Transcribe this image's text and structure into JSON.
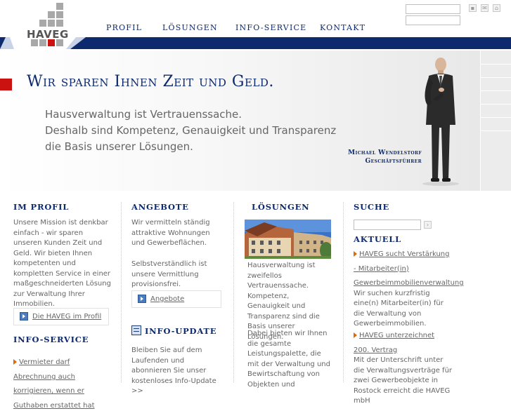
{
  "header": {
    "logo_text": "HAVEG",
    "nav": [
      "Profil",
      "Lösungen",
      "Info-Service",
      "Kontakt"
    ]
  },
  "hero": {
    "title": "Wir sparen Ihnen Zeit und Geld.",
    "lines": [
      "Hausverwaltung ist Vertrauenssache.",
      "Deshalb sind Kompetenz, Genauigkeit und Transparenz",
      "die Basis unserer Lösungen."
    ],
    "person_name": "Michael Wendelstorf",
    "person_role": "Geschäftsführer"
  },
  "profil": {
    "heading": "Im Profil",
    "text": "Unsere Mission ist denkbar einfach - wir sparen unseren Kunden Zeit und Geld. Wir bieten Ihnen kompetenten und kompletten Service in einer maßgeschneiderten Lösung zur Verwaltung Ihrer Immobilien.",
    "button": "Die HAVEG im Profil"
  },
  "info_service": {
    "heading": "Info-Service",
    "link": "Vermieter darf Abrechnung auch korrigieren, wenn er Guthaben erstattet hat"
  },
  "angebote": {
    "heading": "Angebote",
    "text1": "Wir vermitteln ständig attraktive Wohnungen und Gewerbeflächen.",
    "text2": "Selbstverständlich ist unsere Vermittlung provisionsfrei.",
    "button": "Angebote"
  },
  "info_update": {
    "heading": "Info-Update",
    "text": "Bleiben Sie auf dem Laufenden und abonnieren Sie unser kostenloses Info-Update >>"
  },
  "loesungen": {
    "heading": "Lösungen",
    "text1": "Hausverwaltung ist zweifellos Vertrauenssache. Kompetenz, Genauigkeit und Transparenz sind die Basis unserer Lösungen.",
    "text2": "Dabei bieten wir Ihnen die gesamte Leistungspalette, die mit der Verwaltung und Bewirtschaftung von Objekten und"
  },
  "suche": {
    "heading": "Suche"
  },
  "aktuell": {
    "heading": "Aktuell",
    "items": [
      {
        "link": "HAVEG sucht Verstärkung - Mitarbeiter(in) Gewerbeimmobilienverwaltung",
        "text": "Wir suchen kurzfristig eine(n) Mitarbeiter(in) für die Verwaltung von Gewerbeimmobilien."
      },
      {
        "link": "HAVEG unterzeichnet 200. Vertrag",
        "text": "Mit der Unterschrift unter die Verwaltungsverträge für zwei Gewerbeobjekte in Rostock erreicht die HAVEG mbH"
      }
    ]
  },
  "colors": {
    "brand_blue": "#0d2a6e",
    "accent_red": "#cc1111",
    "arrow_orange": "#e06a00"
  }
}
